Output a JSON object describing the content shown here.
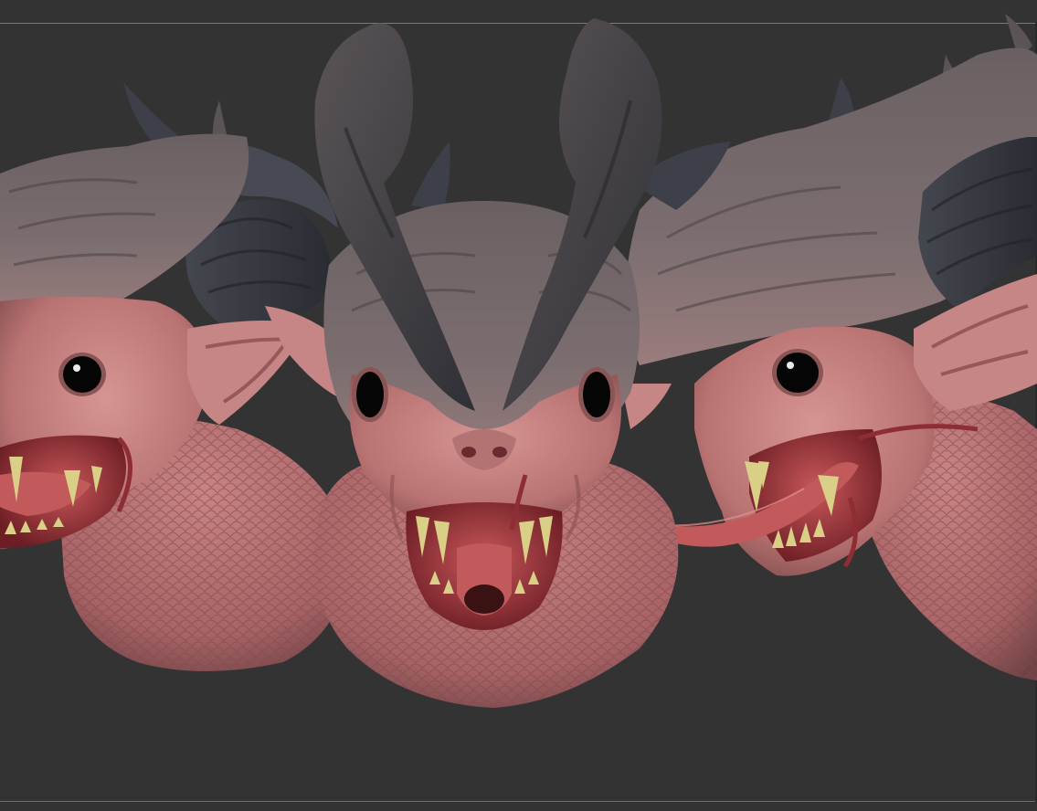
{
  "canvas": {
    "background": "#333333",
    "frame_line_color": "#7a7a7a"
  },
  "subject": {
    "views": [
      "left-profile",
      "front",
      "right-profile"
    ],
    "colors": {
      "skin": "#c78383",
      "skin_shadow": "#8f5656",
      "scales": "#b87274",
      "horn_top": "#5e5656",
      "horn_dark": "#3b3d45",
      "head_cap": "#6e6466",
      "eye": "#050505",
      "mouth": "#7a2127",
      "tongue": "#c25a5c",
      "teeth": "#d9cf86"
    }
  }
}
